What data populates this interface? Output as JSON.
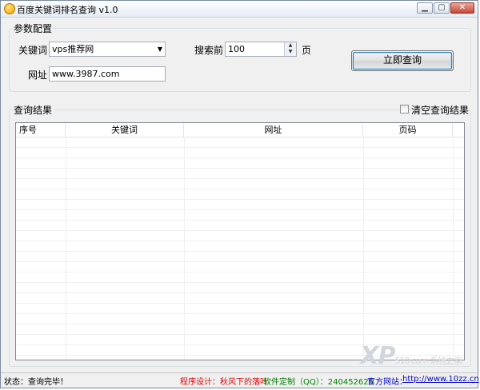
{
  "window": {
    "title": "百度关键词排名查询 v1.0"
  },
  "config": {
    "legend": "参数配置",
    "keyword_label": "关键词",
    "keyword_value": "vps推荐网",
    "url_label": "网址",
    "url_value": "www.3987.com",
    "search_label": "搜索前",
    "search_value": "100",
    "pages_suffix": "页",
    "query_button": "立即查询"
  },
  "results": {
    "legend": "查询结果",
    "clear_label": "清空查询结果",
    "columns": [
      "序号",
      "关键词",
      "网址",
      "页码"
    ]
  },
  "statusbar": {
    "status": "状态：查询完毕！",
    "design": "程序设计：秋风下的落叶",
    "custom": "软件定制（QQ）：240452625",
    "site_prefix": "官方网站：",
    "site_url": "http://www.10zz.cn"
  },
  "watermark": {
    "text": "XP",
    "sub": "510.com 系统之家"
  },
  "colors": {
    "design": "#e00000",
    "custom": "#008000",
    "site": "#0000cc"
  }
}
